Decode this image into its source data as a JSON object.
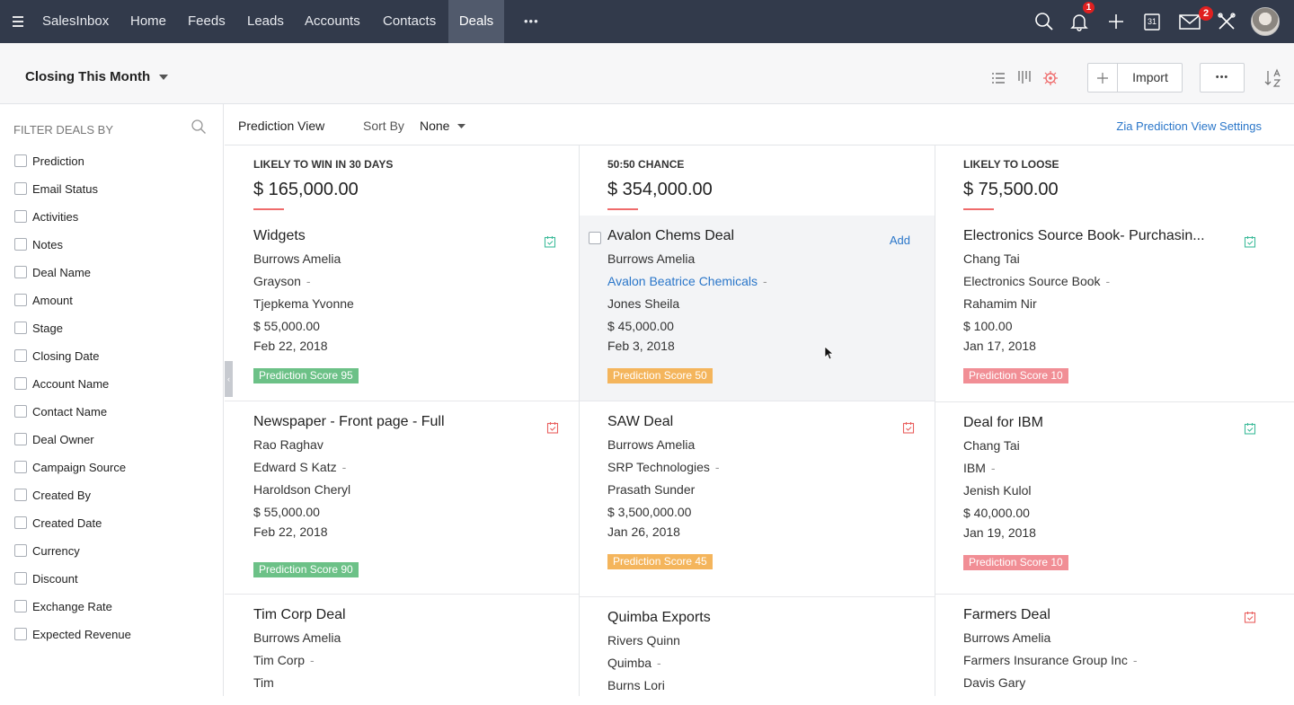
{
  "app": {
    "name": "SalesInbox"
  },
  "nav": [
    {
      "label": "Home"
    },
    {
      "label": "Feeds"
    },
    {
      "label": "Leads"
    },
    {
      "label": "Accounts"
    },
    {
      "label": "Contacts"
    },
    {
      "label": "Deals"
    }
  ],
  "nav_more": "•••",
  "notifications": {
    "bell_count": "1",
    "mail_count": "2"
  },
  "calendar_day": "31",
  "view": {
    "title": "Closing This Month",
    "import_label": "Import",
    "more_label": "•••"
  },
  "sidebar": {
    "heading": "FILTER DEALS BY",
    "items": [
      "Prediction",
      "Email Status",
      "Activities",
      "Notes",
      "Deal Name",
      "Amount",
      "Stage",
      "Closing Date",
      "Account Name",
      "Contact Name",
      "Deal Owner",
      "Campaign Source",
      "Created By",
      "Created Date",
      "Currency",
      "Discount",
      "Exchange Rate",
      "Expected Revenue"
    ]
  },
  "viewbar": {
    "prediction_view": "Prediction View",
    "sort_by": "Sort By",
    "sort_value": "None",
    "settings_link": "Zia Prediction View Settings"
  },
  "columns": [
    {
      "title": "LIKELY TO WIN IN 30 DAYS",
      "amount": "$ 165,000.00",
      "cards": [
        {
          "title": "Widgets",
          "owner": "Burrows Amelia",
          "account": "Grayson",
          "contact": "Tjepkema Yvonne",
          "amount": "$ 55,000.00",
          "date": "Feb 22, 2018",
          "score": "Prediction Score 95"
        },
        {
          "title": "Newspaper - Front page - Full",
          "owner": "Rao Raghav",
          "account": "Edward S Katz",
          "contact": "Haroldson Cheryl",
          "amount": "$ 55,000.00",
          "date": "Feb 22, 2018",
          "score": "Prediction Score 90"
        },
        {
          "title": "Tim Corp Deal",
          "owner": "Burrows Amelia",
          "account": "Tim Corp",
          "contact": "Tim"
        }
      ]
    },
    {
      "title": "50:50 CHANCE",
      "amount": "$ 354,000.00",
      "cards": [
        {
          "title": "Avalon Chems Deal",
          "add": "Add",
          "owner": "Burrows Amelia",
          "account": "Avalon Beatrice Chemicals",
          "contact": "Jones Sheila",
          "amount": "$ 45,000.00",
          "date": "Feb 3, 2018",
          "score": "Prediction Score 50"
        },
        {
          "title": "SAW Deal",
          "owner": "Burrows Amelia",
          "account": "SRP Technologies",
          "contact": "Prasath Sunder",
          "amount": "$ 3,500,000.00",
          "date": "Jan 26, 2018",
          "score": "Prediction Score 45"
        },
        {
          "title": "Quimba Exports",
          "owner": "Rivers Quinn",
          "account": "Quimba",
          "contact": "Burns Lori"
        }
      ]
    },
    {
      "title": "LIKELY TO LOOSE",
      "amount": "$ 75,500.00",
      "cards": [
        {
          "title": "Electronics Source Book- Purchasin...",
          "owner": "Chang Tai",
          "account": "Electronics Source Book",
          "contact": "Rahamim Nir",
          "amount": "$ 100.00",
          "date": "Jan 17, 2018",
          "score": "Prediction Score 10"
        },
        {
          "title": "Deal for IBM",
          "owner": "Chang Tai",
          "account": "IBM",
          "contact": "Jenish Kulol",
          "amount": "$ 40,000.00",
          "date": "Jan 19, 2018",
          "score": "Prediction Score 10"
        },
        {
          "title": "Farmers Deal",
          "owner": "Burrows Amelia",
          "account": "Farmers Insurance Group Inc",
          "contact": "Davis Gary"
        }
      ]
    }
  ],
  "colors": {
    "topbar": "#323a4b",
    "link": "#2a76c9",
    "score_green": "#6cc187",
    "score_orange": "#f4b55c",
    "score_red": "#f18e95",
    "task_green": "#3dbb9a",
    "task_red": "#e9605f"
  },
  "icons": [
    "menu-icon",
    "search-icon",
    "bell-icon",
    "plus-icon",
    "calendar-icon",
    "mail-icon",
    "tools-icon",
    "list-view-icon",
    "kanban-view-icon",
    "prediction-view-icon",
    "sort-az-icon",
    "task-icon",
    "cursor-icon"
  ]
}
